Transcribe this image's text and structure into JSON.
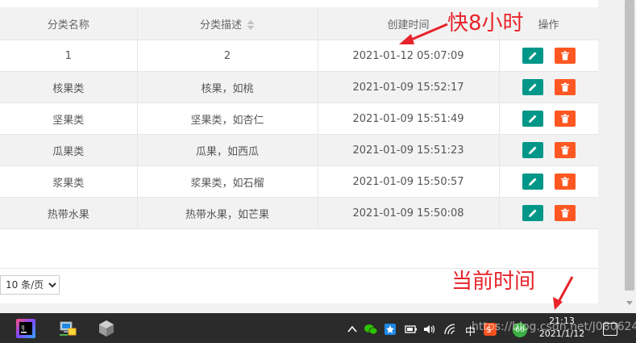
{
  "table": {
    "headers": {
      "name": "分类名称",
      "desc": "分类描述",
      "created": "创建时间",
      "actions": "操作"
    },
    "rows": [
      {
        "name": "1",
        "desc": "2",
        "created": "2021-01-12 05:07:09"
      },
      {
        "name": "核果类",
        "desc": "核果，如桃",
        "created": "2021-01-09 15:52:17"
      },
      {
        "name": "坚果类",
        "desc": "坚果类，如杏仁",
        "created": "2021-01-09 15:51:49"
      },
      {
        "name": "瓜果类",
        "desc": "瓜果，如西瓜",
        "created": "2021-01-09 15:51:23"
      },
      {
        "name": "浆果类",
        "desc": "浆果类，如石榴",
        "created": "2021-01-09 15:50:57"
      },
      {
        "name": "热带水果",
        "desc": "热带水果，如芒果",
        "created": "2021-01-09 15:50:08"
      }
    ]
  },
  "pager": {
    "page_size_label": "10 条/页"
  },
  "annotations": {
    "fast_label": "快8小时",
    "current_label": "当前时间"
  },
  "taskbar": {
    "clock_time": "21:13",
    "clock_date": "2021/1/12",
    "ime_label": "中",
    "badge_count": "66",
    "watermark": "https://blog.csdn.net/J080624"
  },
  "colors": {
    "edit_button": "#009688",
    "delete_button": "#ff5722",
    "annotation": "#e8232a"
  }
}
